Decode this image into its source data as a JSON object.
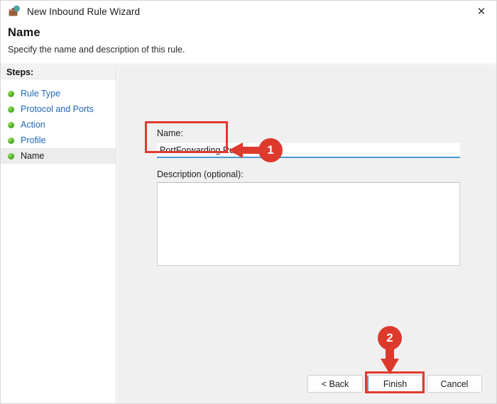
{
  "window": {
    "title": "New Inbound Rule Wizard",
    "icon": "firewall-wizard-icon",
    "close_label": "✕"
  },
  "header": {
    "title": "Name",
    "subtitle": "Specify the name and description of this rule."
  },
  "sidebar": {
    "header_label": "Steps:",
    "items": [
      {
        "label": "Rule Type",
        "state": "completed",
        "bullet": "green-bullet-icon"
      },
      {
        "label": "Protocol and Ports",
        "state": "completed",
        "bullet": "green-bullet-icon"
      },
      {
        "label": "Action",
        "state": "completed",
        "bullet": "green-bullet-icon"
      },
      {
        "label": "Profile",
        "state": "completed",
        "bullet": "green-bullet-icon"
      },
      {
        "label": "Name",
        "state": "current",
        "bullet": "green-bullet-icon"
      }
    ]
  },
  "main": {
    "name_label": "Name:",
    "name_value": "PortForwarding Rule",
    "name_placeholder": "",
    "description_label": "Description (optional):",
    "description_value": "",
    "description_placeholder": ""
  },
  "footer": {
    "back_label": "< Back",
    "finish_label": "Finish",
    "cancel_label": "Cancel"
  },
  "annotations": {
    "badge_1": "1",
    "badge_2": "2",
    "color": "#dd3a2d",
    "box_color": "#e03b2e"
  },
  "colors": {
    "accent_blue": "#2066b5",
    "focus_blue": "#4a9ad4",
    "panel_gray": "#f0f0f0",
    "annotation_red": "#dd3a2d",
    "bullet_green": "#5cb832"
  }
}
